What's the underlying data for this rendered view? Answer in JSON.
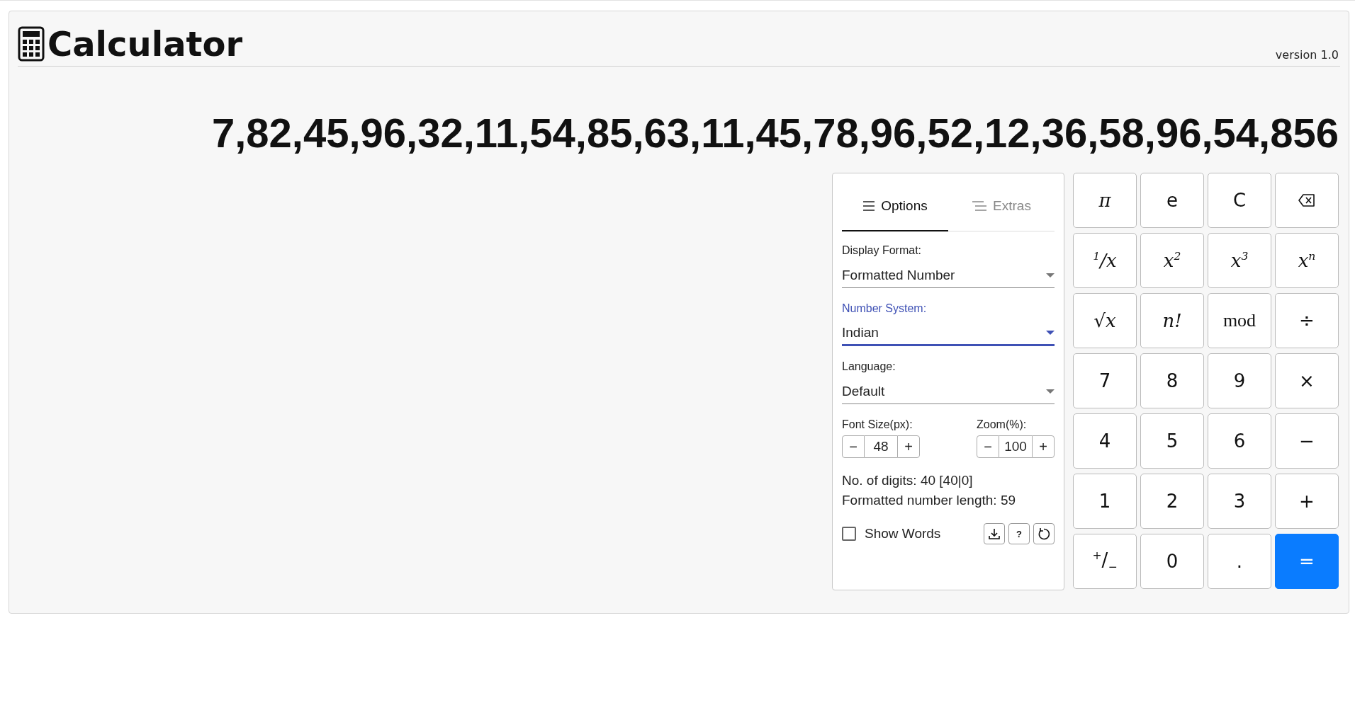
{
  "header": {
    "title": "Calculator",
    "version": "version 1.0"
  },
  "display": {
    "value": "7,82,45,96,32,11,54,85,63,11,45,78,96,52,12,36,58,96,54,856"
  },
  "options": {
    "tabs": [
      {
        "label": "Options",
        "kind": "options",
        "selected": true
      },
      {
        "label": "Extras",
        "kind": "extras",
        "selected": false
      }
    ],
    "selects": [
      {
        "label": "Display Format:",
        "value": "Formatted Number",
        "focused": false
      },
      {
        "label": "Number System:",
        "value": "Indian",
        "focused": true
      },
      {
        "label": "Language:",
        "value": "Default",
        "focused": false
      }
    ],
    "steppers": [
      {
        "label": "Font Size(px):",
        "minus": "−",
        "value": "48",
        "plus": "+"
      },
      {
        "label": "Zoom(%):",
        "minus": "−",
        "value": "100",
        "plus": "+"
      }
    ],
    "stats": [
      "No. of digits: 40 [40|0]",
      "Formatted number length: 59"
    ],
    "show_words": {
      "label": "Show Words",
      "checked": false
    },
    "tools": [
      {
        "kind": "download"
      },
      {
        "kind": "help",
        "label": "?"
      },
      {
        "kind": "reset"
      }
    ]
  },
  "keys": [
    {
      "label": "π",
      "kind": "math"
    },
    {
      "label": "e",
      "kind": "plain"
    },
    {
      "label": "C",
      "kind": "plain"
    },
    {
      "kind": "backspace"
    },
    {
      "label": "$^{1}$/x",
      "kind": "math"
    },
    {
      "label": "x$^{2}$",
      "kind": "math"
    },
    {
      "label": "x$^{3}$",
      "kind": "math"
    },
    {
      "label": "x$^{n}$",
      "kind": "math"
    },
    {
      "label": "√x",
      "kind": "math"
    },
    {
      "label": "n!",
      "kind": "math"
    },
    {
      "label": "mod",
      "kind": "roman"
    },
    {
      "label": "÷",
      "kind": "plain"
    },
    {
      "label": "7",
      "kind": "plain"
    },
    {
      "label": "8",
      "kind": "plain"
    },
    {
      "label": "9",
      "kind": "plain"
    },
    {
      "label": "×",
      "kind": "plain"
    },
    {
      "label": "4",
      "kind": "plain"
    },
    {
      "label": "5",
      "kind": "plain"
    },
    {
      "label": "6",
      "kind": "plain"
    },
    {
      "label": "−",
      "kind": "plain"
    },
    {
      "label": "1",
      "kind": "plain"
    },
    {
      "label": "2",
      "kind": "plain"
    },
    {
      "label": "3",
      "kind": "plain"
    },
    {
      "label": "+",
      "kind": "plain"
    },
    {
      "label": "$^{+}$/$_{−}$",
      "kind": "plain"
    },
    {
      "label": "0",
      "kind": "plain"
    },
    {
      "label": ".",
      "kind": "plain"
    },
    {
      "label": "=",
      "kind": "primary"
    }
  ]
}
